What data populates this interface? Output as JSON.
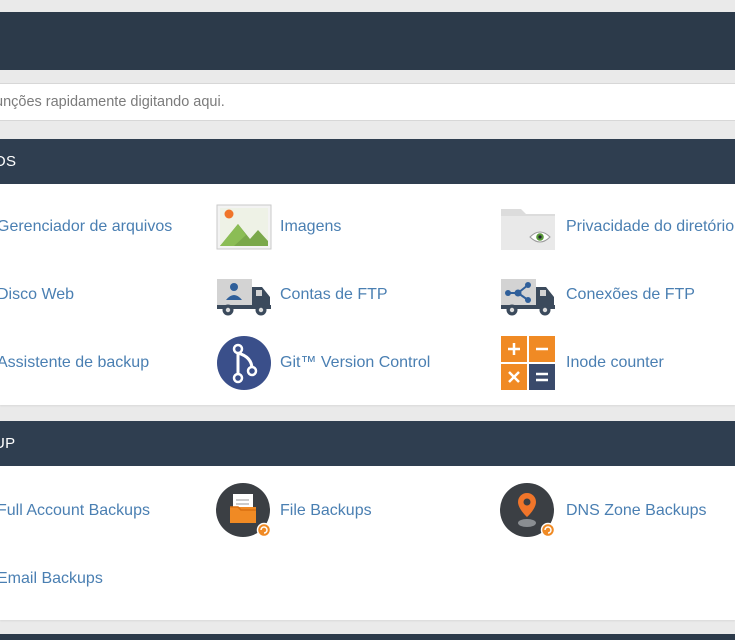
{
  "search": {
    "placeholder": "unções rapidamente digitando aqui."
  },
  "sections": [
    {
      "title": "OS",
      "items": [
        {
          "label": "Gerenciador de arquivos",
          "icon": "file-manager-icon"
        },
        {
          "label": "Imagens",
          "icon": "images-icon"
        },
        {
          "label": "Privacidade do diretório",
          "icon": "directory-privacy-icon"
        },
        {
          "label": "Disco Web",
          "icon": "web-disk-icon"
        },
        {
          "label": "Contas de FTP",
          "icon": "ftp-accounts-icon"
        },
        {
          "label": "Conexões de FTP",
          "icon": "ftp-connections-icon"
        },
        {
          "label": "Assistente de backup",
          "icon": "backup-wizard-icon"
        },
        {
          "label": "Git™ Version Control",
          "icon": "git-icon"
        },
        {
          "label": "Inode counter",
          "icon": "inode-counter-icon"
        }
      ]
    },
    {
      "title": "UP",
      "items": [
        {
          "label": "Full Account Backups",
          "icon": "full-backup-icon"
        },
        {
          "label": "File Backups",
          "icon": "file-backups-icon"
        },
        {
          "label": "DNS Zone Backups",
          "icon": "dns-zone-backups-icon"
        },
        {
          "label": "Email Backups",
          "icon": "email-backups-icon"
        }
      ]
    }
  ],
  "colors": {
    "header": "#2f3e50",
    "link": "#4a7fb2",
    "orange": "#f08a24",
    "navy": "#3a4a6b"
  }
}
